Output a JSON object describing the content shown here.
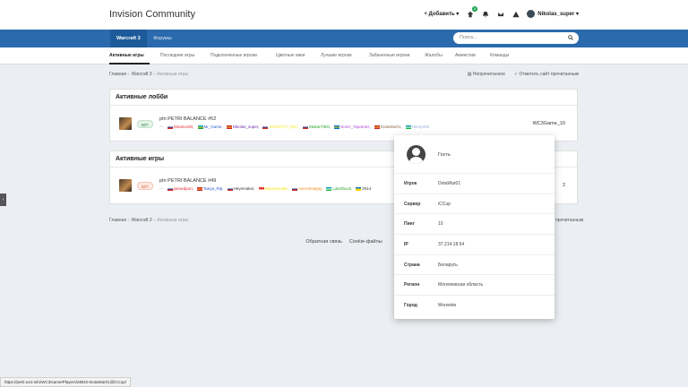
{
  "header": {
    "brand": "Invision Community",
    "add_label": "Добавить",
    "notif_count": "2",
    "username": "Nikolas_super"
  },
  "nav": {
    "items": [
      "Warcraft 3",
      "Форумы"
    ],
    "search_placeholder": "Поиск..."
  },
  "subnav": {
    "items": [
      "Активные игры",
      "Последние игры",
      "Подключенные игроки",
      "Цветные ники",
      "Лучшие игроки",
      "Забаненные игроки",
      "Жалобы",
      "Амнистии",
      "Команды"
    ]
  },
  "breadcrumb": {
    "home": "Главная",
    "section": "Warcraft 3",
    "current": "Активные игры"
  },
  "actions": {
    "unread": "Непрочитанное",
    "mark_read": "Отметить сайт прочитанным"
  },
  "lobbies": {
    "title": "Активные лобби",
    "game": {
      "status": "В/П",
      "name": "ptn PETRI BALANCE #52",
      "host": "WC3Game_10",
      "players": [
        {
          "name": "DinamoXD,",
          "color": "#e0262f",
          "flag": [
            "#fff",
            "#1e3fa0",
            "#d52b1e"
          ]
        },
        {
          "name": "Mr_Game,",
          "color": "#2a59c9",
          "flag": [
            "#00a3dd",
            "#ffd400",
            "#1e9d4c"
          ]
        },
        {
          "name": "Nikolas_super,",
          "color": "#6c2bb0",
          "flag": [
            "#c62828",
            "#fbc02d",
            "#c62828"
          ]
        },
        {
          "name": "XOCOTYI_TOC,",
          "color": "#f5e617",
          "flag": [
            "#fff",
            "#1e3fa0",
            "#d52b1e"
          ]
        },
        {
          "name": "StakanTBG,",
          "color": "#28a428",
          "flag": [
            "#fff",
            "#1e3fa0",
            "#d52b1e"
          ]
        },
        {
          "name": "BooH_TapaKaH,",
          "color": "#b34fd6",
          "flag": [
            "#0072ce",
            "#ffd500",
            "#0072ce"
          ]
        },
        {
          "name": "DotaWar01,",
          "color": "#8a6a4a",
          "flag": [
            "#c62828",
            "#fbc02d",
            "#c62828"
          ]
        },
        {
          "name": "HenryOrk",
          "color": "#8fa8d8",
          "flag": [
            "#0099b5",
            "#fff",
            "#1eb53a"
          ]
        }
      ]
    }
  },
  "games": {
    "title": "Активные игры",
    "game": {
      "status": "В/П",
      "name": "ptn PETRI BALANCE #49",
      "host_suffix": "2",
      "players": [
        {
          "name": "parsedpon,",
          "color": "#e0262f",
          "flag": [
            "#fff",
            "#1e3fa0",
            "#d52b1e"
          ]
        },
        {
          "name": "Tanya_Rip,",
          "color": "#2a59c9",
          "flag": [
            "#c62828",
            "#fbc02d",
            "#c62828"
          ]
        },
        {
          "name": "Heyemaker,",
          "color": "#333333",
          "flag": [
            "#fff",
            "#1e3fa0",
            "#d52b1e"
          ]
        },
        {
          "name": "BlackSoul94,",
          "color": "#f5e617",
          "flag": [
            "#e53935",
            "#e53935",
            "#fff"
          ]
        },
        {
          "name": "AuroraHappy,",
          "color": "#ee8a1e",
          "flag": [
            "#fff",
            "#1e3fa0",
            "#d52b1e"
          ]
        },
        {
          "name": "Lolertbuck,",
          "color": "#28a428",
          "flag": [
            "#0099b5",
            "#fff",
            "#1eb53a"
          ]
        },
        {
          "name": "2014",
          "color": "#333333",
          "flag": [
            "#0072ce",
            "#ffd500",
            "#ffd500"
          ]
        }
      ]
    }
  },
  "footer": {
    "feedback": "Обратная связь",
    "cookies": "Cookie-файлы",
    "mark_read_tail": "прочитанным"
  },
  "status_url": "https://petri.wc3.info/WC3Game/Players/28910-DotaWar01@iCCup/",
  "popup": {
    "user": "Гость",
    "rows": [
      {
        "label": "Игрок",
        "value": "DotaWar01"
      },
      {
        "label": "Сервер",
        "value": "iCCup"
      },
      {
        "label": "Пинг",
        "value": "10"
      },
      {
        "label": "IP",
        "value": "37.214.18.54"
      },
      {
        "label": "Страна",
        "value": "Беларусь"
      },
      {
        "label": "Регион",
        "value": "Могилевская область"
      },
      {
        "label": "Город",
        "value": "Могилёв"
      }
    ]
  }
}
